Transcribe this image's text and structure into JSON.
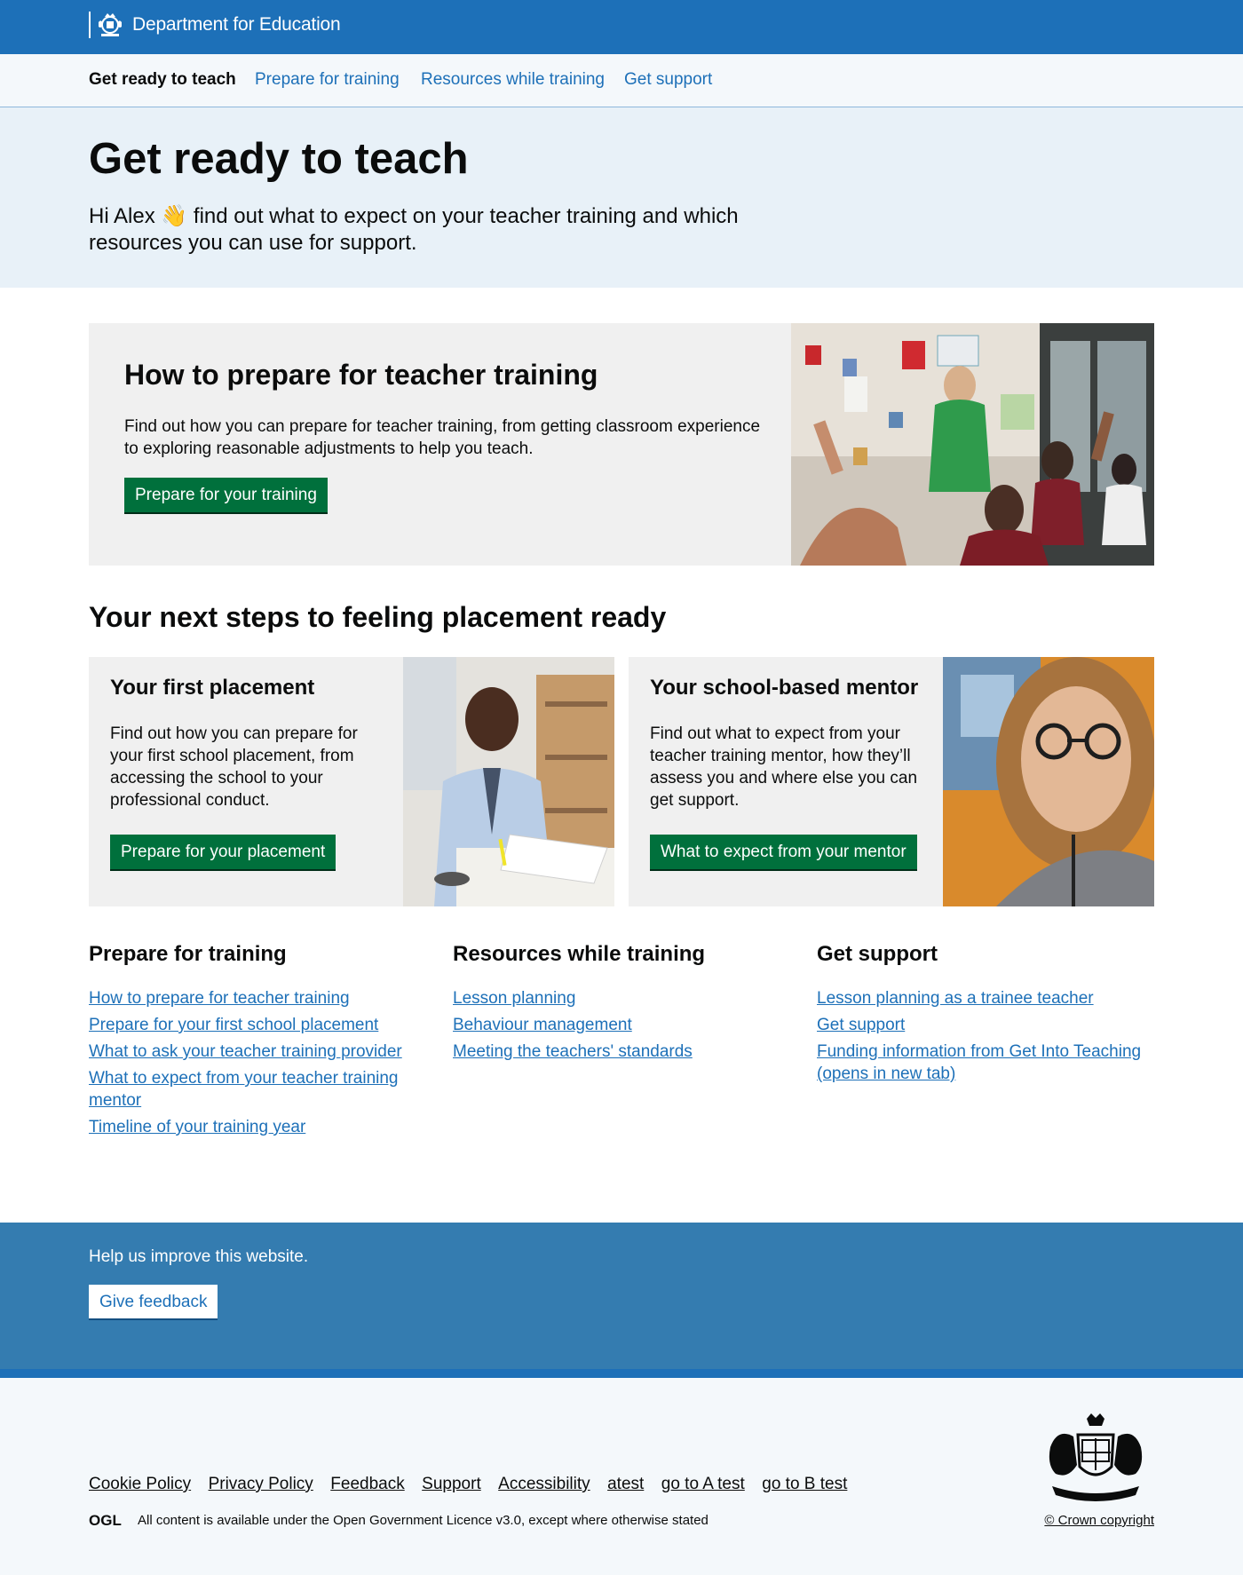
{
  "header": {
    "title": "Department for Education",
    "colors": {
      "brand": "#1d70b8",
      "nav_bg": "#f4f8fb",
      "hero_bg": "#e8f1f8",
      "button_green": "#00703c",
      "feedback_bg": "#347cb0"
    }
  },
  "service_nav": {
    "items": [
      {
        "label": "Get ready to teach",
        "active": true
      },
      {
        "label": "Prepare for training",
        "active": false
      },
      {
        "label": "Resources while training",
        "active": false
      },
      {
        "label": "Get support",
        "active": false
      }
    ]
  },
  "hero": {
    "heading": "Get ready to teach",
    "intro": "Hi Alex 👋 find out what to expect on your teacher training and which resources you can use for support."
  },
  "feature": {
    "heading": "How to prepare for teacher training",
    "body": "Find out how you can prepare for teacher training, from getting classroom experience to exploring reasonable adjustments to help you teach.",
    "button": "Prepare for your training",
    "image": "classroom-photo"
  },
  "next_steps": {
    "heading": "Your next steps to feeling placement ready",
    "cards": [
      {
        "heading": "Your first placement",
        "body": "Find out how you can prepare for your first school placement, from accessing the school to your professional conduct.",
        "button": "Prepare for your placement",
        "image": "trainee-teacher-photo"
      },
      {
        "heading": "Your school-based mentor",
        "body": "Find out what to expect from your teacher training mentor, how they’ll assess you and where else you can get support.",
        "button": "What to expect from your mentor",
        "image": "mentor-portrait-photo"
      }
    ]
  },
  "link_columns": [
    {
      "heading": "Prepare for training",
      "links": [
        "How to prepare for teacher training",
        "Prepare for your first school placement",
        "What to ask your teacher training provider",
        "What to expect from your teacher training mentor",
        "Timeline of your training year"
      ]
    },
    {
      "heading": "Resources while training",
      "links": [
        "Lesson planning",
        "Behaviour management",
        "Meeting the teachers' standards"
      ]
    },
    {
      "heading": "Get support",
      "links": [
        "Lesson planning as a trainee teacher",
        "Get support",
        "Funding information from Get Into Teaching (opens in new tab)"
      ]
    }
  ],
  "feedback": {
    "text": "Help us improve this website.",
    "button": "Give feedback"
  },
  "footer": {
    "links": [
      "Cookie Policy",
      "Privacy Policy",
      "Feedback",
      "Support",
      "Accessibility",
      "atest",
      "go to A test",
      "go to B test"
    ],
    "licence_prefix": "All content is available under the ",
    "licence_link": "Open Government Licence v3.0",
    "licence_suffix": ", except where otherwise stated",
    "ogl_logo": "OGL",
    "copyright": "© Crown copyright"
  }
}
